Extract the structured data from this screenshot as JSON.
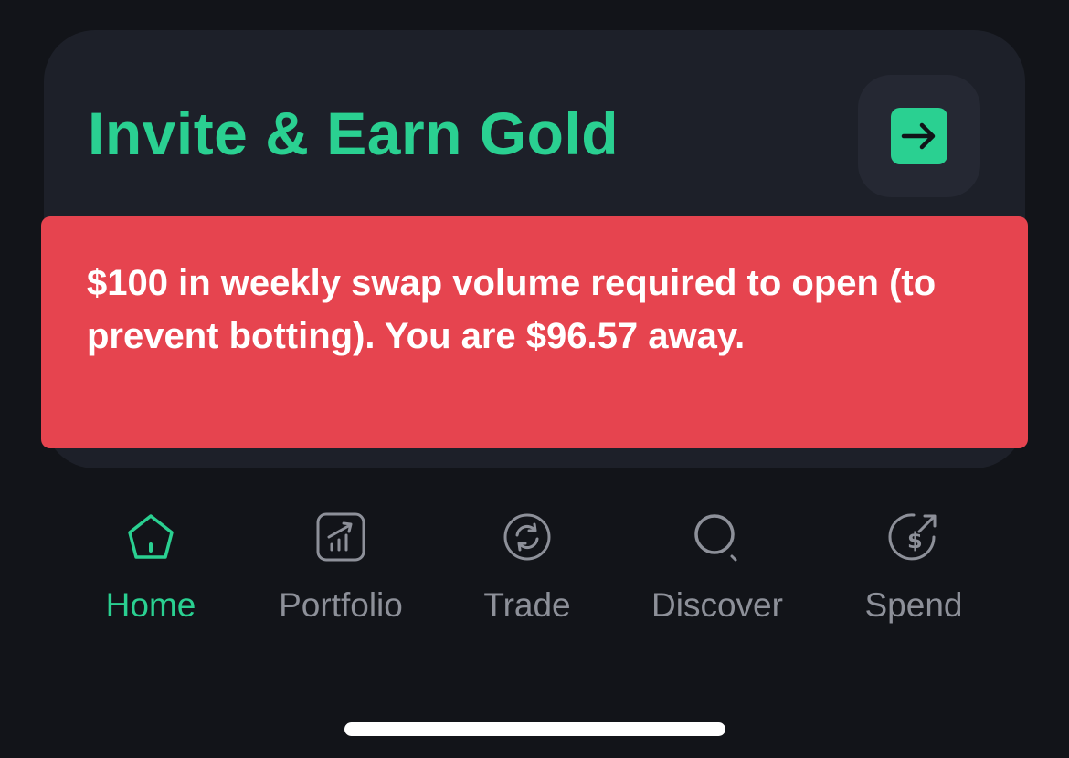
{
  "card": {
    "title": "Invite & Earn Gold",
    "arrow_icon": "arrow-right-icon"
  },
  "alert": {
    "message": "$100 in weekly swap volume required to open (to prevent botting). You are $96.57 away."
  },
  "tabbar": {
    "active": "Home",
    "tabs": [
      {
        "label": "Home",
        "icon": "home-icon"
      },
      {
        "label": "Portfolio",
        "icon": "portfolio-chart-icon"
      },
      {
        "label": "Trade",
        "icon": "swap-arrows-icon"
      },
      {
        "label": "Discover",
        "icon": "search-icon"
      },
      {
        "label": "Spend",
        "icon": "dollar-send-icon"
      }
    ]
  },
  "colors": {
    "background": "#121419",
    "card": "#1d2029",
    "accent": "#2ad091",
    "alert": "#e6444f",
    "inactive_tab": "#8d9099"
  }
}
